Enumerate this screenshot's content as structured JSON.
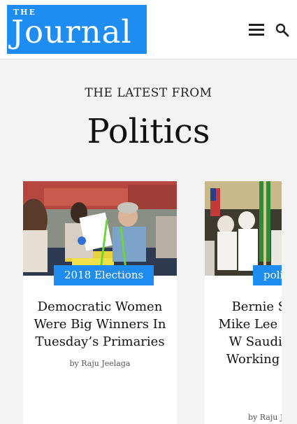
{
  "header": {
    "logo_small": "THE",
    "logo_big": "Journal"
  },
  "section": {
    "kicker": "THE LATEST FROM",
    "title": "Politics"
  },
  "cards": [
    {
      "badge": "2018 Elections",
      "headline": "Democratic Women Were Big Winners In Tuesday’s Primaries",
      "byline": "by Raju Jeelaga"
    },
    {
      "badge": "poli",
      "headline": "Bernie San Mike Lee Fight W Saudis. T Working The",
      "byline": "by Raju J"
    }
  ],
  "colors": {
    "brand": "#1e8cf0",
    "background": "#f3f3f3"
  }
}
